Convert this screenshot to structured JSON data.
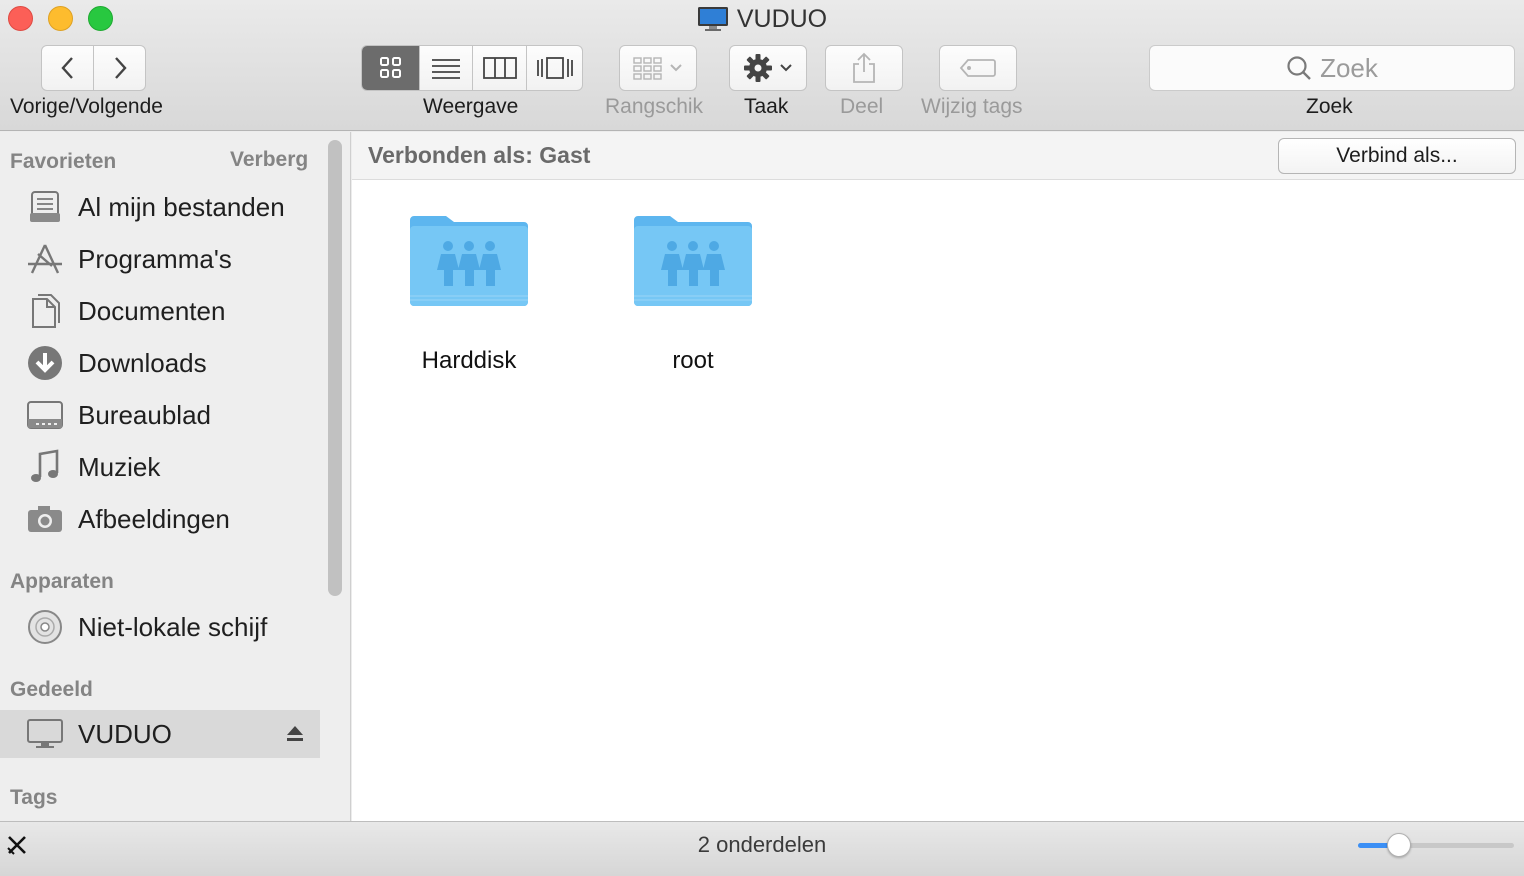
{
  "window": {
    "title": "VUDUO"
  },
  "toolbar": {
    "nav_label": "Vorige/Volgende",
    "view_label": "Weergave",
    "arrange_label": "Rangschik",
    "action_label": "Taak",
    "share_label": "Deel",
    "tags_label": "Wijzig tags",
    "search_placeholder": "Zoek",
    "search_label": "Zoek",
    "active_view": "icon-view"
  },
  "sidebar": {
    "favorites_header": "Favorieten",
    "hide_label": "Verberg",
    "favorites": [
      {
        "label": "Al mijn bestanden",
        "icon": "all-files-icon"
      },
      {
        "label": "Programma's",
        "icon": "applications-icon"
      },
      {
        "label": "Documenten",
        "icon": "documents-icon"
      },
      {
        "label": "Downloads",
        "icon": "downloads-icon"
      },
      {
        "label": "Bureaublad",
        "icon": "desktop-icon"
      },
      {
        "label": "Muziek",
        "icon": "music-icon"
      },
      {
        "label": "Afbeeldingen",
        "icon": "pictures-icon"
      }
    ],
    "devices_header": "Apparaten",
    "devices": [
      {
        "label": "Niet-lokale schijf",
        "icon": "disc-icon"
      }
    ],
    "shared_header": "Gedeeld",
    "shared": [
      {
        "label": "VUDUO",
        "icon": "computer-icon",
        "selected": true
      }
    ],
    "tags_header": "Tags"
  },
  "content": {
    "connected_as": "Verbonden als: Gast",
    "connect_button": "Verbind als...",
    "items": [
      {
        "name": "Harddisk",
        "icon": "shared-folder-icon"
      },
      {
        "name": "root",
        "icon": "shared-folder-icon"
      }
    ]
  },
  "statusbar": {
    "item_count": "2 onderdelen",
    "icon_size_fraction": 0.26
  },
  "colors": {
    "accent": "#3b8ff5",
    "folder": "#6ec3f4",
    "close": "#fc5f57",
    "minimize": "#fdbc2e",
    "maximize": "#28c840"
  }
}
